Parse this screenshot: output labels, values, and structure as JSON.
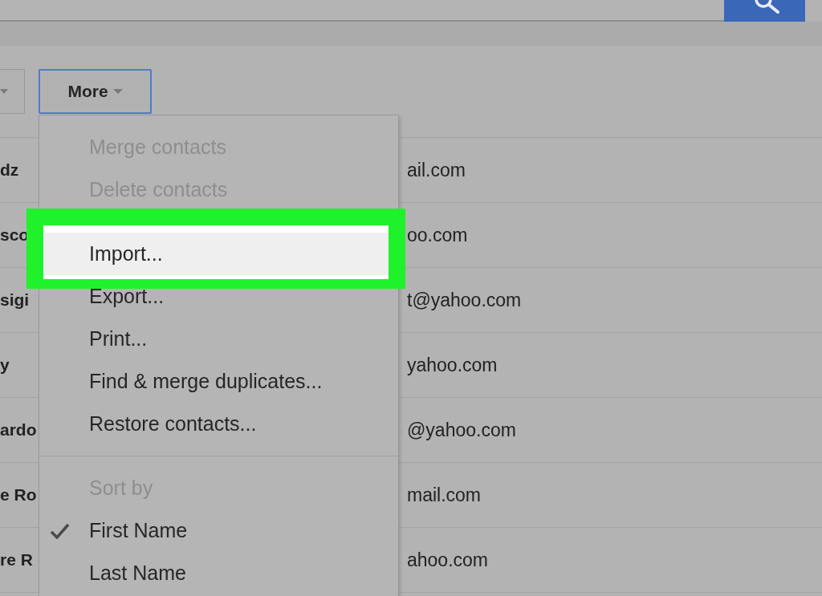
{
  "toolbar": {
    "more_button": {
      "label": "More"
    }
  },
  "contacts": [
    {
      "name": "dz",
      "email": "ail.com"
    },
    {
      "name": "sco",
      "email": "oo.com"
    },
    {
      "name": "sigi",
      "email": "t@yahoo.com"
    },
    {
      "name": "y",
      "email": "yahoo.com"
    },
    {
      "name": "ardo",
      "email": "@yahoo.com"
    },
    {
      "name": "e Ro",
      "email": "mail.com"
    },
    {
      "name": "re R",
      "email": "ahoo.com"
    }
  ],
  "more_menu": {
    "sections": [
      {
        "items": [
          {
            "kind": "action",
            "label": "Merge contacts",
            "disabled": true,
            "highlighted": false
          },
          {
            "kind": "action",
            "label": "Delete contacts",
            "disabled": true,
            "highlighted": false
          }
        ]
      },
      {
        "items": [
          {
            "kind": "action",
            "label": "Import...",
            "disabled": false,
            "highlighted": true
          },
          {
            "kind": "action",
            "label": "Export...",
            "disabled": false,
            "highlighted": false
          },
          {
            "kind": "action",
            "label": "Print...",
            "disabled": false,
            "highlighted": false
          },
          {
            "kind": "action",
            "label": "Find & merge duplicates...",
            "disabled": false,
            "highlighted": false
          },
          {
            "kind": "action",
            "label": "Restore contacts...",
            "disabled": false,
            "highlighted": false
          }
        ]
      },
      {
        "items": [
          {
            "kind": "header",
            "label": "Sort by"
          },
          {
            "kind": "option",
            "label": "First Name",
            "checked": true
          },
          {
            "kind": "option",
            "label": "Last Name",
            "checked": false
          }
        ]
      }
    ]
  }
}
